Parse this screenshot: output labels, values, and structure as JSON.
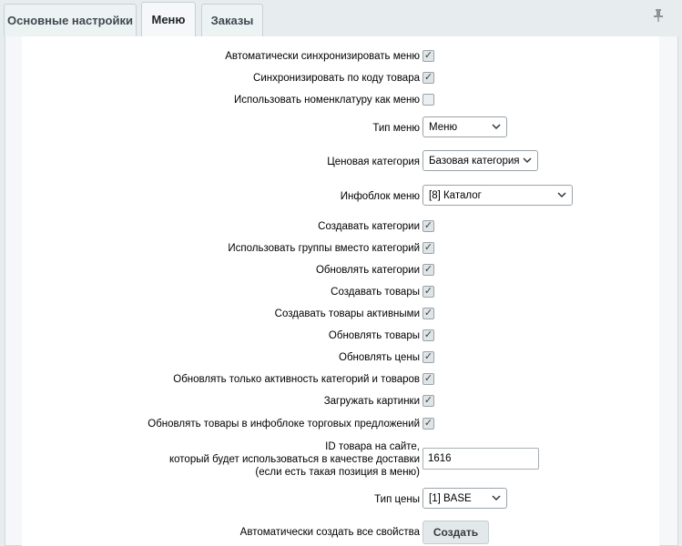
{
  "tabs": [
    {
      "label": "Основные настройки"
    },
    {
      "label": "Меню"
    },
    {
      "label": "Заказы"
    }
  ],
  "pin_icon": "pin-icon",
  "settings": {
    "auto_sync_menu": {
      "label": "Автоматически синхронизировать меню",
      "checked": true
    },
    "sync_by_code": {
      "label": "Синхронизировать по коду товара",
      "checked": true
    },
    "use_nomenclature": {
      "label": "Использовать номенклатуру как меню",
      "checked": false
    },
    "menu_type": {
      "label": "Тип меню",
      "value": "Меню"
    },
    "price_category": {
      "label": "Ценовая категория",
      "value": "Базовая категория"
    },
    "infoblock_menu": {
      "label": "Инфоблок меню",
      "value": "[8] Каталог"
    },
    "create_categories": {
      "label": "Создавать категории",
      "checked": true
    },
    "use_groups": {
      "label": "Использовать группы вместо категорий",
      "checked": true
    },
    "update_categories": {
      "label": "Обновлять категории",
      "checked": true
    },
    "create_products": {
      "label": "Создавать товары",
      "checked": true
    },
    "create_products_active": {
      "label": "Создавать товары активными",
      "checked": true
    },
    "update_products": {
      "label": "Обновлять товары",
      "checked": true
    },
    "update_prices": {
      "label": "Обновлять цены",
      "checked": true
    },
    "update_activity_only": {
      "label": "Обновлять только активность категорий и товаров",
      "checked": true
    },
    "load_images": {
      "label": "Загружать картинки",
      "checked": true
    },
    "update_offers": {
      "label": "Обновлять товары в инфоблоке торговых предложений",
      "checked": true
    },
    "delivery_id": {
      "label_line1": "ID товара на сайте,",
      "label_line2": "который будет использоваться в качестве доставки",
      "label_line3": "(если есть такая позиция в меню)",
      "value": "1616"
    },
    "price_type": {
      "label": "Тип цены",
      "value": "[1] BASE"
    },
    "auto_create_props": {
      "label": "Автоматически создать все свойства",
      "button_label": "Создать"
    }
  },
  "check_glyph": "✓",
  "chevron_glyph": "⌄"
}
